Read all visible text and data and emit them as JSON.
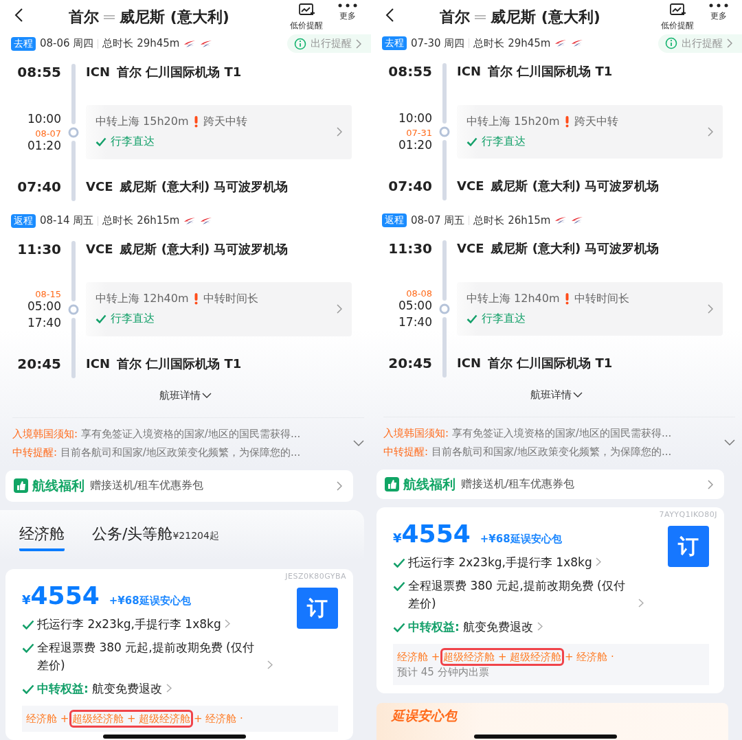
{
  "phones": [
    {
      "header": {
        "from": "首尔",
        "to": "威尼斯 (意大利)",
        "actions": [
          {
            "kind": "price-alert",
            "label": "低价提醒"
          },
          {
            "kind": "more",
            "label": "更多"
          }
        ]
      },
      "trips": [
        {
          "tag": "去程",
          "date": "08-06 周四",
          "duration": "总时长 29h45m",
          "reminder": "出行提醒",
          "departure": {
            "time": "08:55",
            "code": "ICN",
            "airport": "首尔 仁川国际机场 T1"
          },
          "transfer": {
            "arrive": {
              "time": "10:00"
            },
            "depart": {
              "date": "08-07",
              "time": "01:20"
            },
            "info": "中转上海 15h20m",
            "warning": "跨天中转",
            "baggage": "行李直达"
          },
          "arrival": {
            "time": "07:40",
            "code": "VCE",
            "airport": "威尼斯 (意大利) 马可波罗机场"
          }
        },
        {
          "tag": "返程",
          "date": "08-14 周五",
          "duration": "总时长 26h15m",
          "departure": {
            "time": "11:30",
            "code": "VCE",
            "airport": "威尼斯 (意大利) 马可波罗机场"
          },
          "transfer": {
            "arrive": {
              "date": "08-15",
              "time": "05:00"
            },
            "depart": {
              "time": "17:40"
            },
            "info": "中转上海 12h40m",
            "warning": "中转时间长",
            "baggage": "行李直达"
          },
          "arrival": {
            "time": "20:45",
            "code": "ICN",
            "airport": "首尔 仁川国际机场 T1"
          }
        }
      ],
      "details_link": "航班详情",
      "notices": [
        {
          "label": "入境韩国须知:",
          "text": "享有免签证入境资格的国家/地区的国民需获得..."
        },
        {
          "label": "中转提醒:",
          "text": "目前各航司和国家/地区政策变化频繁，为保障您的..."
        }
      ],
      "benefit": {
        "badge": "航线福利",
        "text": "赠接送机/租车优惠券包"
      },
      "cabin_tabs": [
        {
          "label": "经济舱",
          "selected": true
        },
        {
          "label": "公务/头等舱",
          "price": "¥21204",
          "suffix": "起",
          "selected": false
        }
      ],
      "fare": {
        "code": "JESZ0K80GYBA",
        "currency": "¥",
        "price": "4554",
        "addon": "+¥68延误安心包",
        "book": "订",
        "features": [
          {
            "kind": "plain",
            "text": "托运行李 2x23kg,手提行李 1x8kg"
          },
          {
            "kind": "plain",
            "text": "全程退票费 380 元起,提前改期免费 (仅付差价)"
          },
          {
            "kind": "labeled",
            "label": "中转权益:",
            "text": "航变免费退改"
          }
        ],
        "classes": {
          "before": "经济舱 + ",
          "highlighted": "超级经济舱 + 超级经济舱",
          "after": " + 经济舱 ·"
        }
      }
    },
    {
      "header": {
        "from": "首尔",
        "to": "威尼斯 (意大利)",
        "actions": [
          {
            "kind": "price-alert",
            "label": "低价提醒"
          },
          {
            "kind": "more",
            "label": "更多"
          }
        ]
      },
      "trips": [
        {
          "tag": "去程",
          "date": "07-30 周四",
          "duration": "总时长 29h45m",
          "reminder": "出行提醒",
          "departure": {
            "time": "08:55",
            "code": "ICN",
            "airport": "首尔 仁川国际机场 T1"
          },
          "transfer": {
            "arrive": {
              "time": "10:00"
            },
            "depart": {
              "date": "07-31",
              "time": "01:20"
            },
            "info": "中转上海 15h20m",
            "warning": "跨天中转",
            "baggage": "行李直达"
          },
          "arrival": {
            "time": "07:40",
            "code": "VCE",
            "airport": "威尼斯 (意大利) 马可波罗机场"
          }
        },
        {
          "tag": "返程",
          "date": "08-07 周五",
          "duration": "总时长 26h15m",
          "departure": {
            "time": "11:30",
            "code": "VCE",
            "airport": "威尼斯 (意大利) 马可波罗机场"
          },
          "transfer": {
            "arrive": {
              "date": "08-08",
              "time": "05:00"
            },
            "depart": {
              "time": "17:40"
            },
            "info": "中转上海 12h40m",
            "warning": "中转时间长",
            "baggage": "行李直达"
          },
          "arrival": {
            "time": "20:45",
            "code": "ICN",
            "airport": "首尔 仁川国际机场 T1"
          }
        }
      ],
      "details_link": "航班详情",
      "notices": [
        {
          "label": "入境韩国须知:",
          "text": "享有免签证入境资格的国家/地区的国民需获得..."
        },
        {
          "label": "中转提醒:",
          "text": "目前各航司和国家/地区政策变化频繁，为保障您的..."
        }
      ],
      "benefit": {
        "badge": "航线福利",
        "text": "赠接送机/租车优惠券包"
      },
      "fare": {
        "code": "7AYYQ1IKO80J",
        "currency": "¥",
        "price": "4554",
        "addon": "+¥68延误安心包",
        "book": "订",
        "features": [
          {
            "kind": "plain",
            "text": "托运行李 2x23kg,手提行李 1x8kg"
          },
          {
            "kind": "plain",
            "text": "全程退票费 380 元起,提前改期免费 (仅付差价)"
          },
          {
            "kind": "labeled",
            "label": "中转权益:",
            "text": "航变免费退改"
          }
        ],
        "classes": {
          "before": "经济舱 + ",
          "highlighted": "超级经济舱 + 超级经济舱",
          "after": " + 经济舱 ·"
        },
        "note": "预计 45 分钟内出票"
      },
      "banner": "延误安心包"
    }
  ]
}
